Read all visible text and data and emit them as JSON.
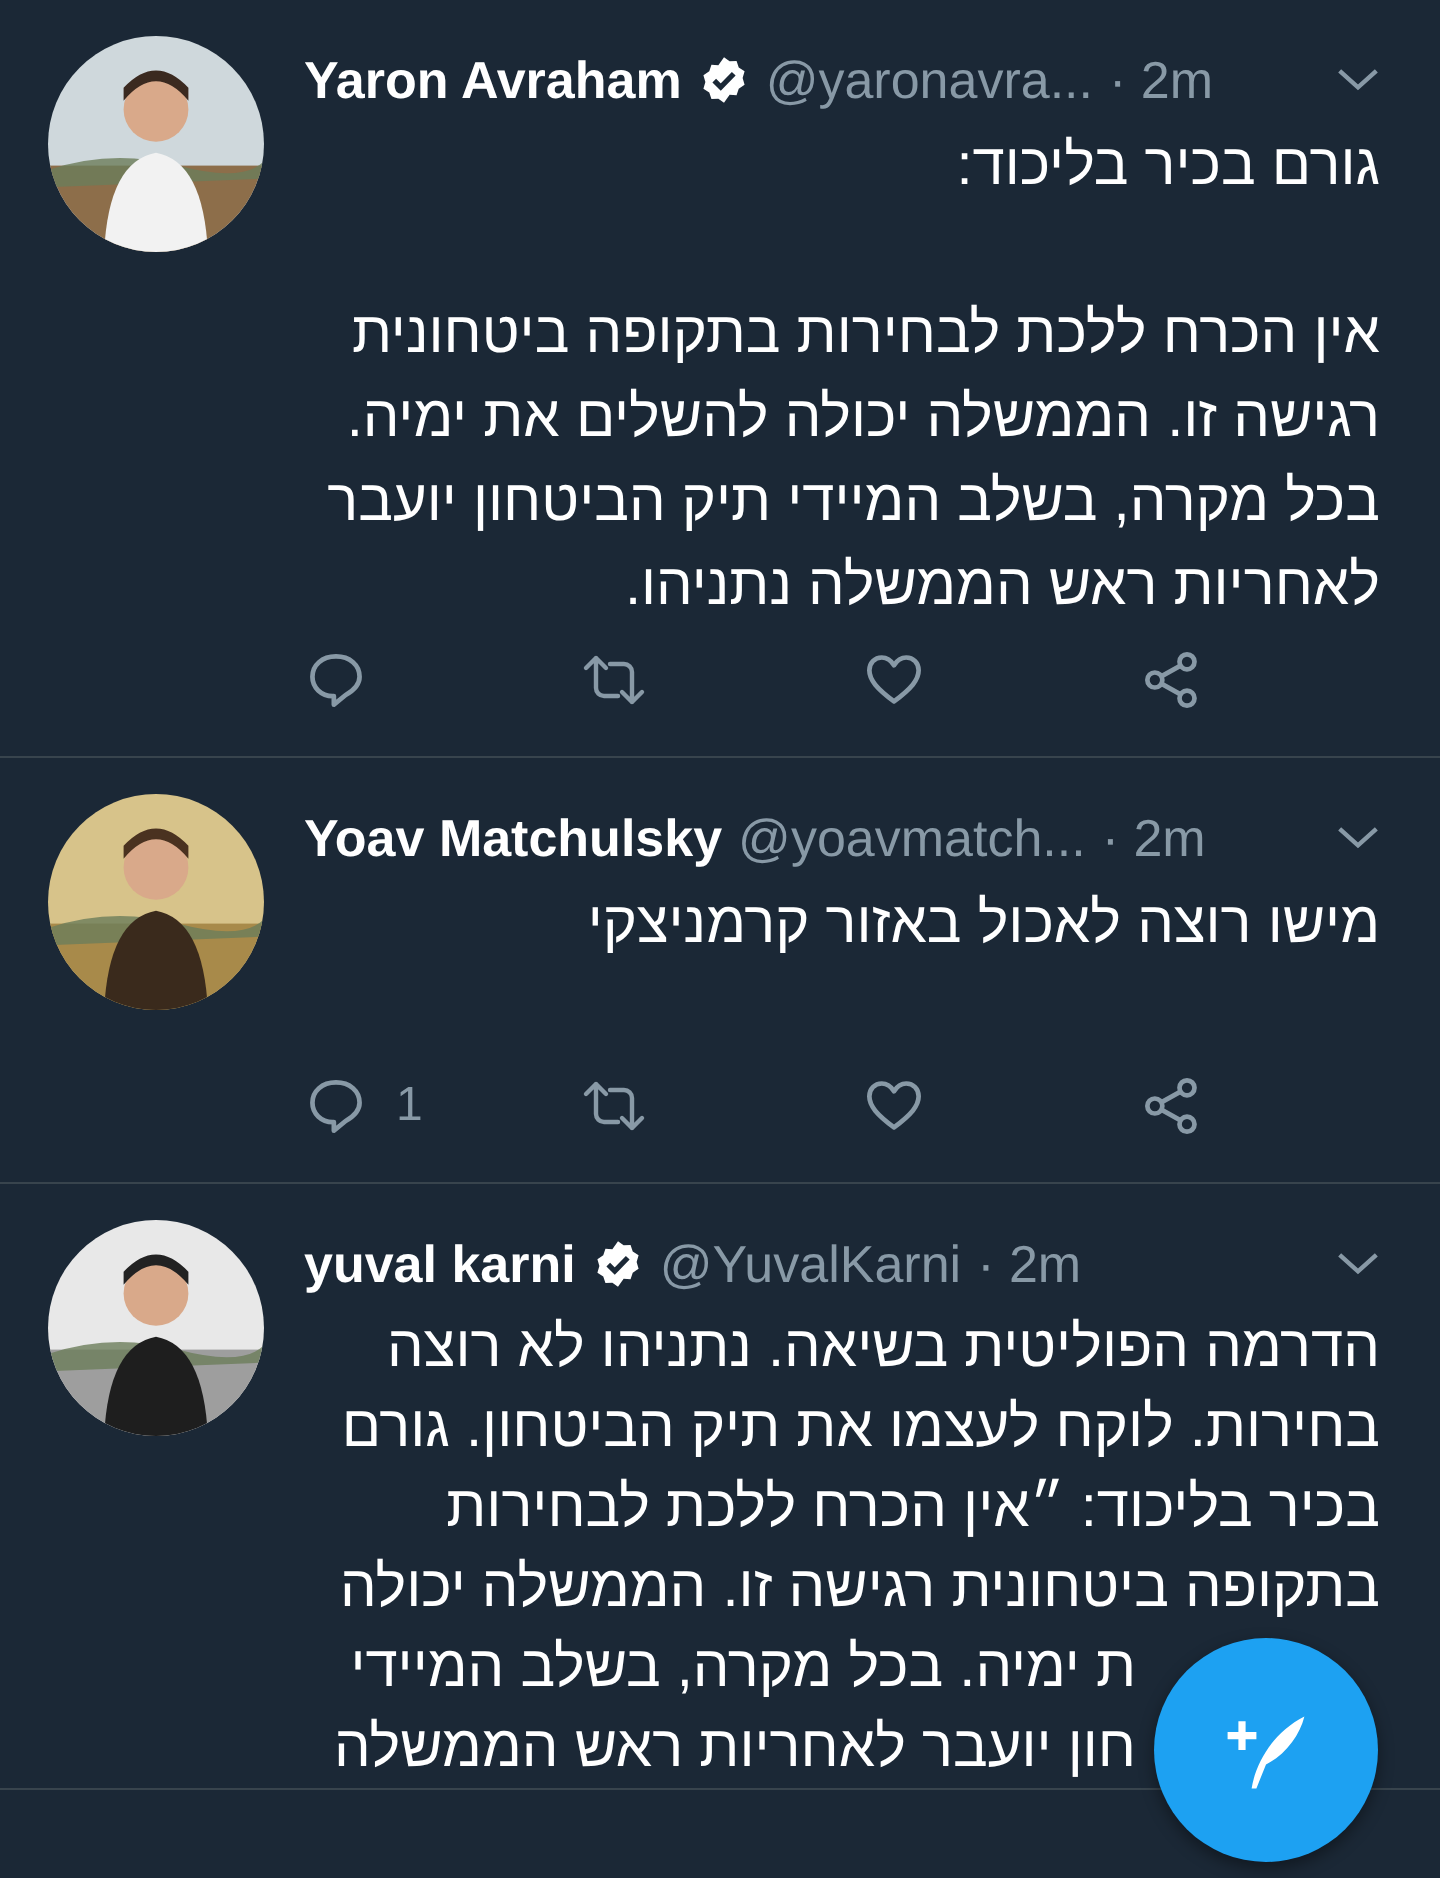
{
  "tweets": [
    {
      "name": "Yaron Avraham",
      "verified": true,
      "handle": "@yaronavra...",
      "time": "· 2m",
      "text": "גורם בכיר בליכוד:\n\nאין הכרח ללכת לבחירות בתקופה ביטחונית רגישה זו. הממשלה יכולה להשלים את ימיה. בכל מקרה, בשלב המיידי תיק הביטחון יועבר לאחריות ראש הממשלה נתניהו.",
      "actions": [
        {
          "kind": "reply"
        },
        {
          "kind": "retweet"
        },
        {
          "kind": "like"
        },
        {
          "kind": "share"
        }
      ]
    },
    {
      "name": "Yoav Matchulsky",
      "verified": false,
      "handle": "@yoavmatch...",
      "time": "· 2m",
      "text": "מישו רוצה לאכול באזור קרמניצקי",
      "actions": [
        {
          "kind": "reply",
          "count": "1"
        },
        {
          "kind": "retweet"
        },
        {
          "kind": "like"
        },
        {
          "kind": "share"
        }
      ]
    },
    {
      "name": "yuval karni",
      "verified": true,
      "handle": "@YuvalKarni",
      "time": "· 2m",
      "lines": [
        {
          "kind": "full",
          "text": "הדרמה הפוליטית בשיאה. נתניהו לא רוצה"
        },
        {
          "kind": "full",
          "text": "בחירות. לוקח לעצמו את תיק הביטחון. גורם"
        },
        {
          "kind": "full",
          "text": "בכיר בליכוד: ״אין הכרח ללכת לבחירות"
        },
        {
          "kind": "full",
          "text": "בתקופה ביטחונית רגישה זו. הממשלה יכולה"
        },
        {
          "kind": "covered",
          "text": "ת ימיה. בכל מקרה, בשלב המיידי"
        },
        {
          "kind": "covered",
          "text": "חון יועבר לאחריות ראש הממשלה"
        }
      ]
    }
  ]
}
